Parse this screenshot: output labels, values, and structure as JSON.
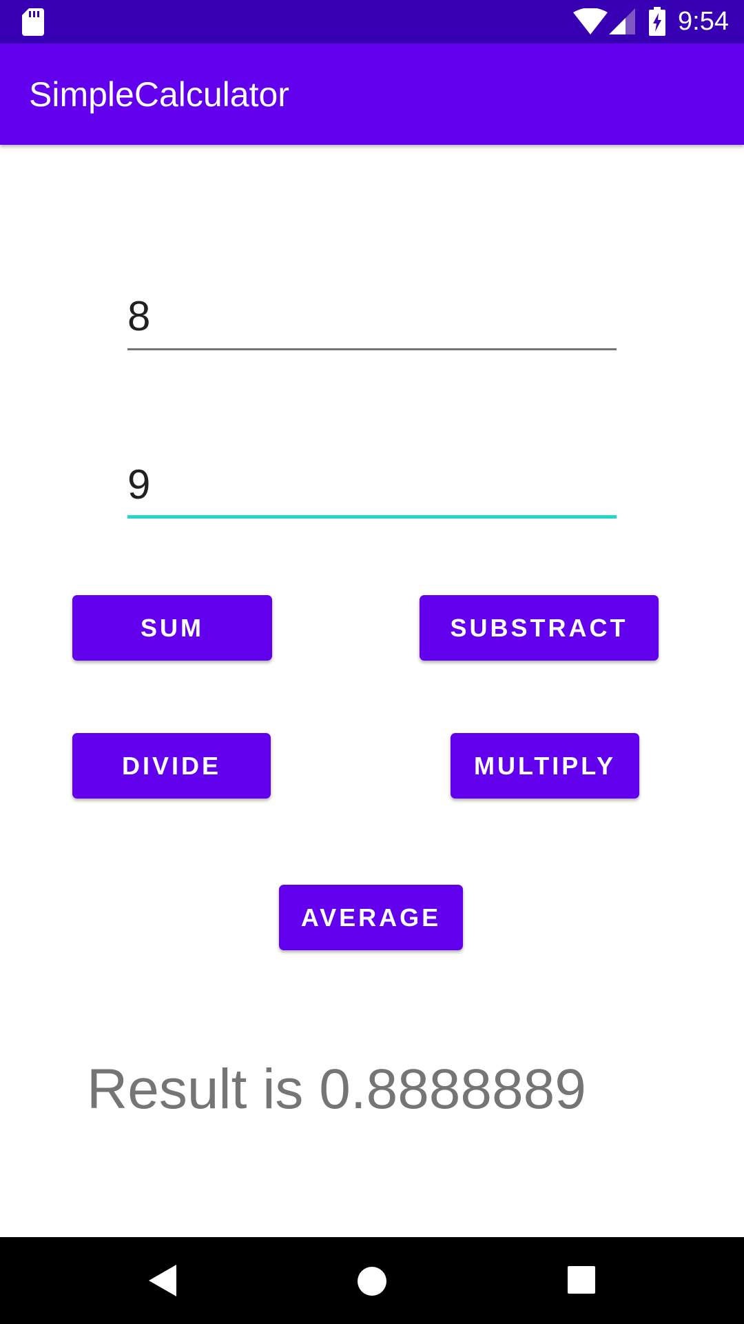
{
  "status_bar": {
    "time": "9:54",
    "icons": [
      "sd-card-icon",
      "wifi-icon",
      "signal-icon",
      "battery-charging-icon"
    ]
  },
  "app_bar": {
    "title": "SimpleCalculator"
  },
  "inputs": {
    "first_number": "8",
    "second_number": "9"
  },
  "buttons": {
    "sum": "SUM",
    "substract": "SUBSTRACT",
    "divide": "DIVIDE",
    "multiply": "MULTIPLY",
    "average": "AVERAGE"
  },
  "result": {
    "text": "Result is 0.8888889"
  },
  "nav_bar": {
    "icons": [
      "back-icon",
      "home-icon",
      "recents-icon"
    ]
  },
  "colors": {
    "status_bar": "#3700b3",
    "primary": "#6200ee",
    "accent": "#26d6c6",
    "result_text": "#757575"
  }
}
